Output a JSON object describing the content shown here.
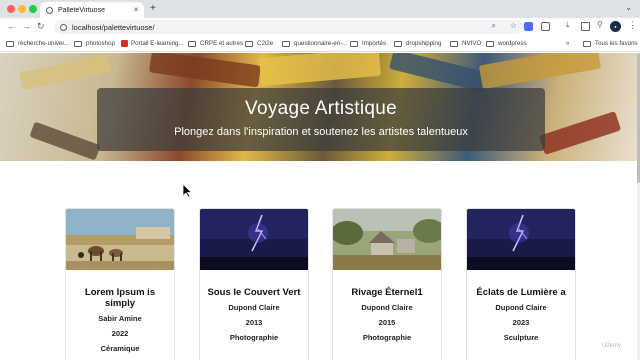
{
  "browser": {
    "tab_title": "PalleteVirtuose",
    "new_tab": "+",
    "url": "localhost/palettevirtuose/",
    "bookmarks": [
      "recherche-univer...",
      "photoshop",
      "Portail E-learning...",
      "CRPE et autres",
      "C2i2e",
      "questionnaire-en-...",
      "Importés",
      "dropshipping",
      "NVIVO",
      "wordpress"
    ],
    "more_bookmarks": "»",
    "all_favorites": "Tous les favoris"
  },
  "hero": {
    "title": "Voyage Artistique",
    "subtitle": "Plongez dans l'inspiration et soutenez les artistes talentueux"
  },
  "cards": [
    {
      "title": "Lorem Ipsum is simply",
      "artist": "Sabir Amine",
      "year": "2022",
      "category": "Céramique",
      "image": "camels-desert-scene"
    },
    {
      "title": "Sous le Couvert Vert",
      "artist": "Dupond Claire",
      "year": "2013",
      "category": "Photographie",
      "image": "lightning-night-sky"
    },
    {
      "title": "Rivage Éternel1",
      "artist": "Dupond Claire",
      "year": "2015",
      "category": "Photographie",
      "image": "cottage-landscape-painting"
    },
    {
      "title": "Éclats de Lumière a",
      "artist": "Dupond Claire",
      "year": "2023",
      "category": "Sculpture",
      "image": "lightning-night-sky"
    }
  ],
  "watermark": "Udemy",
  "colors": {
    "hero_panel": "#3c3c3c",
    "tab_bar": "#dee1e6"
  }
}
